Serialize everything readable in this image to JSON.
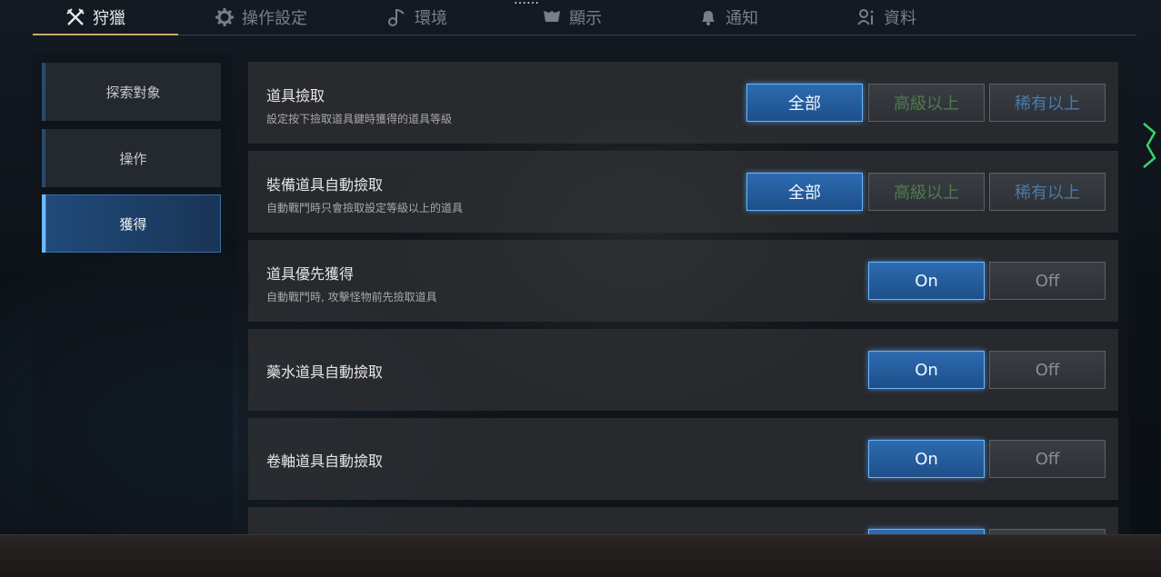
{
  "top_clip_text": "……",
  "tabs": [
    {
      "label": "狩獵",
      "icon": "crossed-swords-icon",
      "active": true
    },
    {
      "label": "操作設定",
      "icon": "gear-icon"
    },
    {
      "label": "環境",
      "icon": "music-note-icon"
    },
    {
      "label": "顯示",
      "icon": "display-icon"
    },
    {
      "label": "通知",
      "icon": "bell-icon"
    },
    {
      "label": "資料",
      "icon": "user-info-icon"
    }
  ],
  "sidebar": {
    "items": [
      {
        "label": "探索對象"
      },
      {
        "label": "操作"
      },
      {
        "label": "獲得",
        "active": true
      }
    ]
  },
  "settings": [
    {
      "title": "道具撿取",
      "desc": "設定按下撿取道具鍵時獲得的道具等級",
      "options": [
        "全部",
        "高級以上",
        "稀有以上"
      ],
      "selected": "全部"
    },
    {
      "title": "裝備道具自動撿取",
      "desc": "自動戰鬥時只會撿取設定等級以上的道具",
      "options": [
        "全部",
        "高級以上",
        "稀有以上"
      ],
      "selected": "全部"
    },
    {
      "title": "道具優先獲得",
      "desc": "自動戰鬥時, 攻擊怪物前先撿取道具",
      "options": [
        "On",
        "Off"
      ],
      "selected": "On"
    },
    {
      "title": "藥水道具自動撿取",
      "options": [
        "On",
        "Off"
      ],
      "selected": "On"
    },
    {
      "title": "卷軸道具自動撿取",
      "options": [
        "On",
        "Off"
      ],
      "selected": "On"
    }
  ],
  "colors": {
    "accent_blue": "#2d6bb0",
    "active_underline": "#c9a867",
    "tier_high": "#4f7a4f",
    "tier_rare": "#4a7aa8"
  }
}
